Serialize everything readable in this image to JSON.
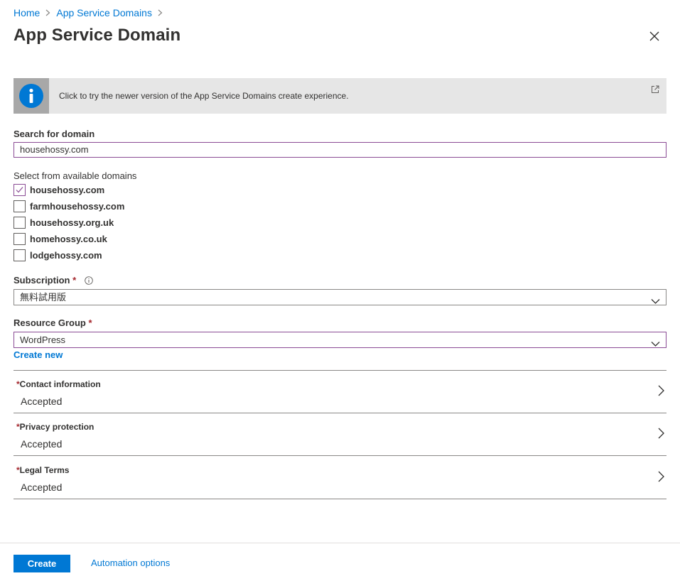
{
  "breadcrumb": [
    {
      "label": "Home"
    },
    {
      "label": "App Service Domains"
    }
  ],
  "page_title": "App Service Domain",
  "banner": {
    "text": "Click to try the newer version of the App Service Domains create experience.",
    "icon": "info-icon",
    "external_icon": "external-link-icon"
  },
  "search": {
    "label": "Search for domain",
    "value": "househossy.com"
  },
  "available": {
    "label": "Select from available domains",
    "domains": [
      {
        "name": "househossy.com",
        "checked": true
      },
      {
        "name": "farmhousehossy.com",
        "checked": false
      },
      {
        "name": "househossy.org.uk",
        "checked": false
      },
      {
        "name": "homehossy.co.uk",
        "checked": false
      },
      {
        "name": "lodgehossy.com",
        "checked": false
      }
    ]
  },
  "subscription": {
    "label": "Subscription",
    "required_mark": "*",
    "value": "無料試用版"
  },
  "resource_group": {
    "label": "Resource Group",
    "required_mark": "*",
    "value": "WordPress",
    "create_new": "Create new"
  },
  "sections": [
    {
      "required_mark": "*",
      "title": "Contact information",
      "value": "Accepted"
    },
    {
      "required_mark": "*",
      "title": "Privacy protection",
      "value": "Accepted"
    },
    {
      "required_mark": "*",
      "title": "Legal Terms",
      "value": "Accepted"
    }
  ],
  "footer": {
    "create_label": "Create",
    "automation_label": "Automation options"
  },
  "colors": {
    "accent": "#0078d4",
    "focus_border": "#8a4b94",
    "required": "#a4262c",
    "banner_bg": "#e6e6e6"
  }
}
